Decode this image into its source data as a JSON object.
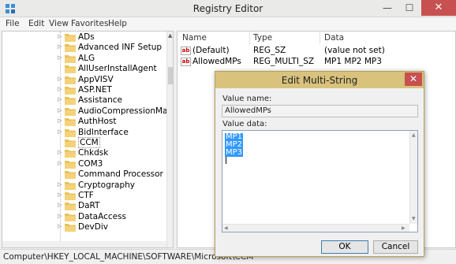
{
  "window": {
    "title": "Registry Editor",
    "min_glyph": "—",
    "max_glyph": "☐",
    "close_glyph": "✕"
  },
  "menu": [
    "File",
    "Edit",
    "View",
    "Favorites",
    "Help"
  ],
  "tree": {
    "items": [
      {
        "label": "ADs",
        "expandable": true
      },
      {
        "label": "Advanced INF Setup",
        "expandable": true
      },
      {
        "label": "ALG",
        "expandable": true
      },
      {
        "label": "AllUserInstallAgent",
        "expandable": false
      },
      {
        "label": "AppVISV",
        "expandable": true
      },
      {
        "label": "ASP.NET",
        "expandable": true
      },
      {
        "label": "Assistance",
        "expandable": true
      },
      {
        "label": "AudioCompressionManager",
        "expandable": true
      },
      {
        "label": "AuthHost",
        "expandable": true
      },
      {
        "label": "BidInterface",
        "expandable": true
      },
      {
        "label": "CCM",
        "expandable": false,
        "selected": true
      },
      {
        "label": "Chkdsk",
        "expandable": true
      },
      {
        "label": "COM3",
        "expandable": true
      },
      {
        "label": "Command Processor",
        "expandable": false
      },
      {
        "label": "Cryptography",
        "expandable": true
      },
      {
        "label": "CTF",
        "expandable": true
      },
      {
        "label": "DaRT",
        "expandable": true
      },
      {
        "label": "DataAccess",
        "expandable": true
      },
      {
        "label": "DevDiv",
        "expandable": true
      }
    ]
  },
  "list": {
    "columns": [
      "Name",
      "Type",
      "Data"
    ],
    "rows": [
      {
        "icon": "ab",
        "name": "(Default)",
        "type": "REG_SZ",
        "data": "(value not set)"
      },
      {
        "icon": "ab",
        "name": "AllowedMPs",
        "type": "REG_MULTI_SZ",
        "data": "MP1 MP2 MP3"
      }
    ]
  },
  "status": {
    "path": "Computer\\HKEY_LOCAL_MACHINE\\SOFTWARE\\Microsoft\\CCM"
  },
  "dialog": {
    "title": "Edit Multi-String",
    "value_name_label": "Value name:",
    "value_name": "AllowedMPs",
    "value_data_label": "Value data:",
    "value_data_lines": [
      "MP1",
      "MP2",
      "MP3"
    ],
    "ok_label": "OK",
    "cancel_label": "Cancel",
    "close_glyph": "✕"
  },
  "colors": {
    "dialog_title_bg": "#d8c27c",
    "close_button": "#c75050",
    "selection": "#3399ff",
    "folder": "#e8c25a"
  }
}
